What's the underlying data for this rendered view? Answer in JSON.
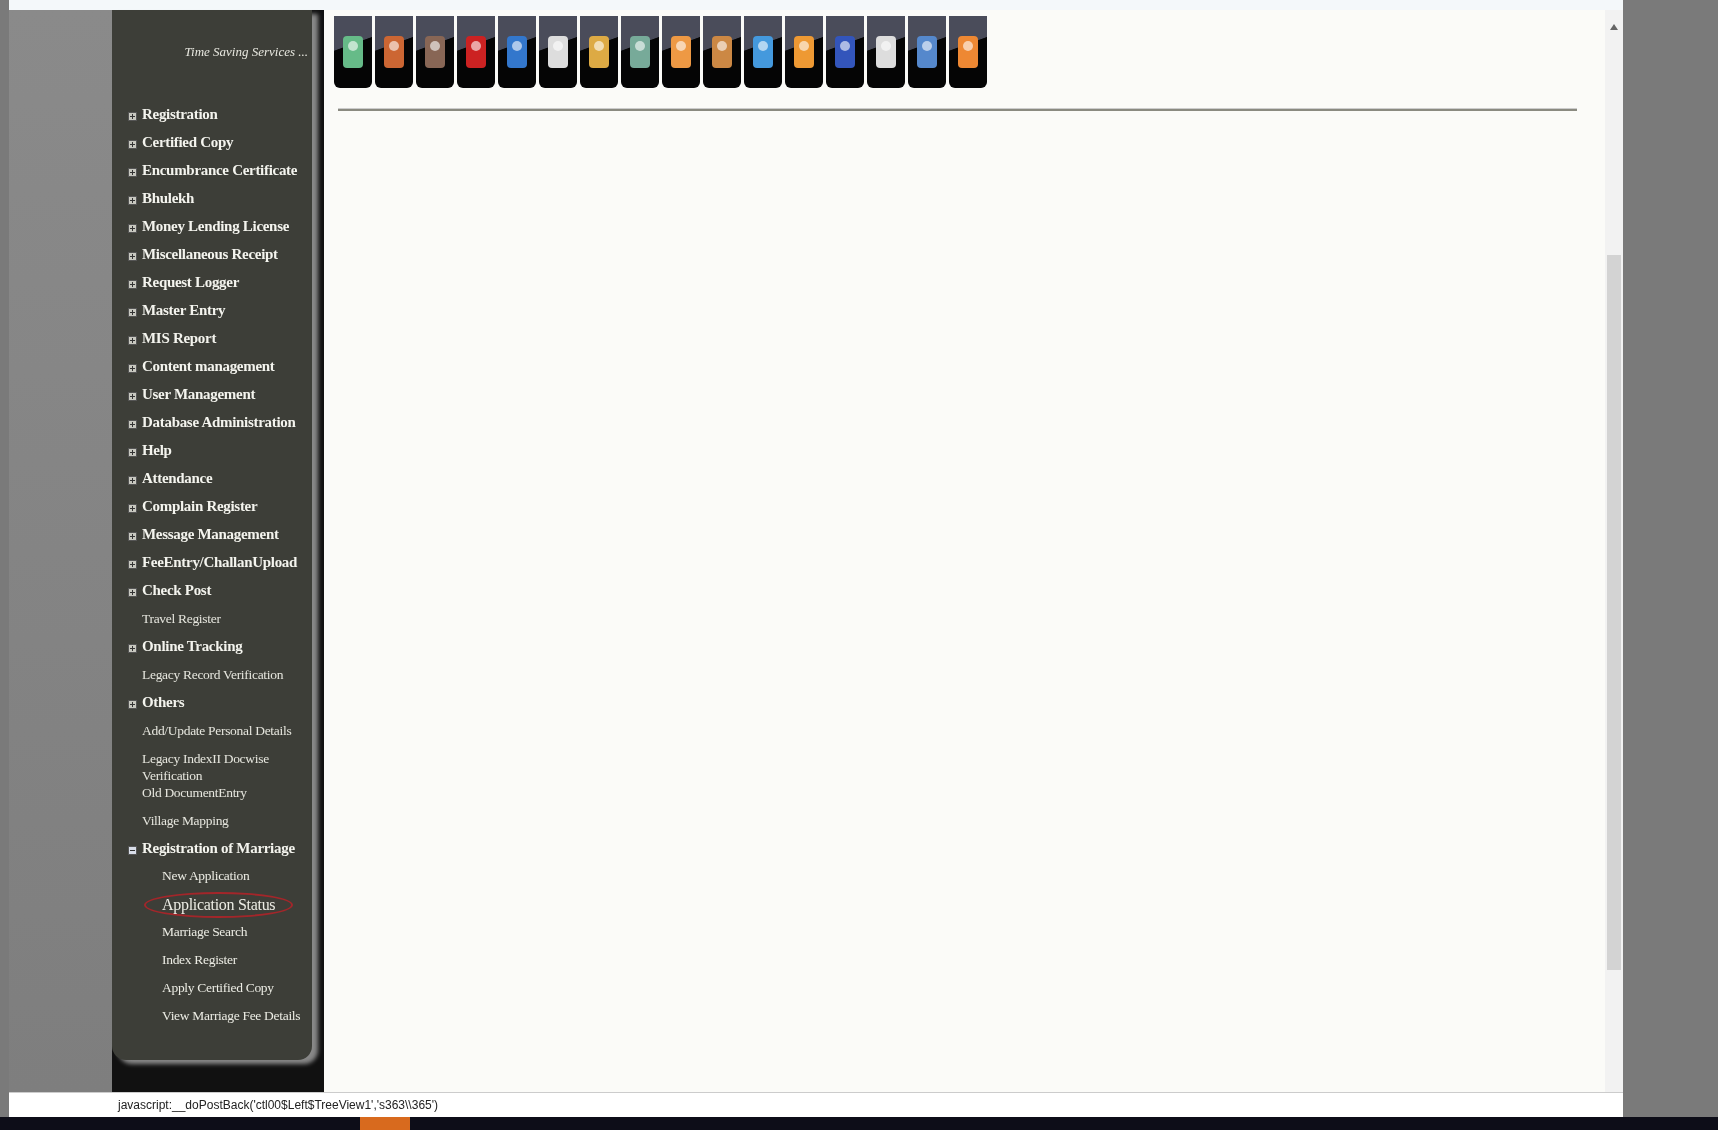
{
  "sidebar": {
    "tagline": "Time Saving Services ...",
    "items": [
      {
        "label": "Registration",
        "kind": "node",
        "expanded": false
      },
      {
        "label": "Certified Copy",
        "kind": "node",
        "expanded": false
      },
      {
        "label": "Encumbrance Certificate",
        "kind": "node",
        "expanded": false
      },
      {
        "label": "Bhulekh",
        "kind": "node",
        "expanded": false
      },
      {
        "label": "Money Lending License",
        "kind": "node",
        "expanded": false
      },
      {
        "label": "Miscellaneous Receipt",
        "kind": "node",
        "expanded": false
      },
      {
        "label": "Request Logger",
        "kind": "node",
        "expanded": false
      },
      {
        "label": "Master Entry",
        "kind": "node",
        "expanded": false
      },
      {
        "label": "MIS Report",
        "kind": "node",
        "expanded": false
      },
      {
        "label": "Content management",
        "kind": "node",
        "expanded": false
      },
      {
        "label": "User Management",
        "kind": "node",
        "expanded": false
      },
      {
        "label": "Database Administration",
        "kind": "node",
        "expanded": false
      },
      {
        "label": "Help",
        "kind": "node",
        "expanded": false
      },
      {
        "label": "Attendance",
        "kind": "node",
        "expanded": false
      },
      {
        "label": "Complain Register",
        "kind": "node",
        "expanded": false
      },
      {
        "label": "Message Management",
        "kind": "node",
        "expanded": false
      },
      {
        "label": "FeeEntry/ChallanUpload",
        "kind": "node",
        "expanded": false
      },
      {
        "label": "Check Post",
        "kind": "node",
        "expanded": false
      },
      {
        "label": "Travel Register",
        "kind": "leaf"
      },
      {
        "label": "Online Tracking",
        "kind": "node",
        "expanded": false
      },
      {
        "label": "Legacy Record Verification",
        "kind": "leaf"
      },
      {
        "label": "Others",
        "kind": "node",
        "expanded": false
      },
      {
        "label": "Add/Update Personal Details",
        "kind": "leaf"
      },
      {
        "label": "Legacy IndexII Docwise Verification",
        "kind": "leaf"
      },
      {
        "label": "Old DocumentEntry",
        "kind": "leaf"
      },
      {
        "label": "Village Mapping",
        "kind": "leaf"
      },
      {
        "label": "Registration of Marriage",
        "kind": "node",
        "expanded": true,
        "children": [
          {
            "label": "New Application",
            "highlighted": false
          },
          {
            "label": "Application Status",
            "highlighted": true
          },
          {
            "label": "Marriage Search",
            "highlighted": false
          },
          {
            "label": "Index Register",
            "highlighted": false
          },
          {
            "label": "Apply Certified Copy",
            "highlighted": false
          },
          {
            "label": "View Marriage Fee Details",
            "highlighted": false
          }
        ]
      }
    ]
  },
  "status_bar": {
    "text": "javascript:__doPostBack('ctl00$Left$TreeView1','s363\\\\365')"
  }
}
